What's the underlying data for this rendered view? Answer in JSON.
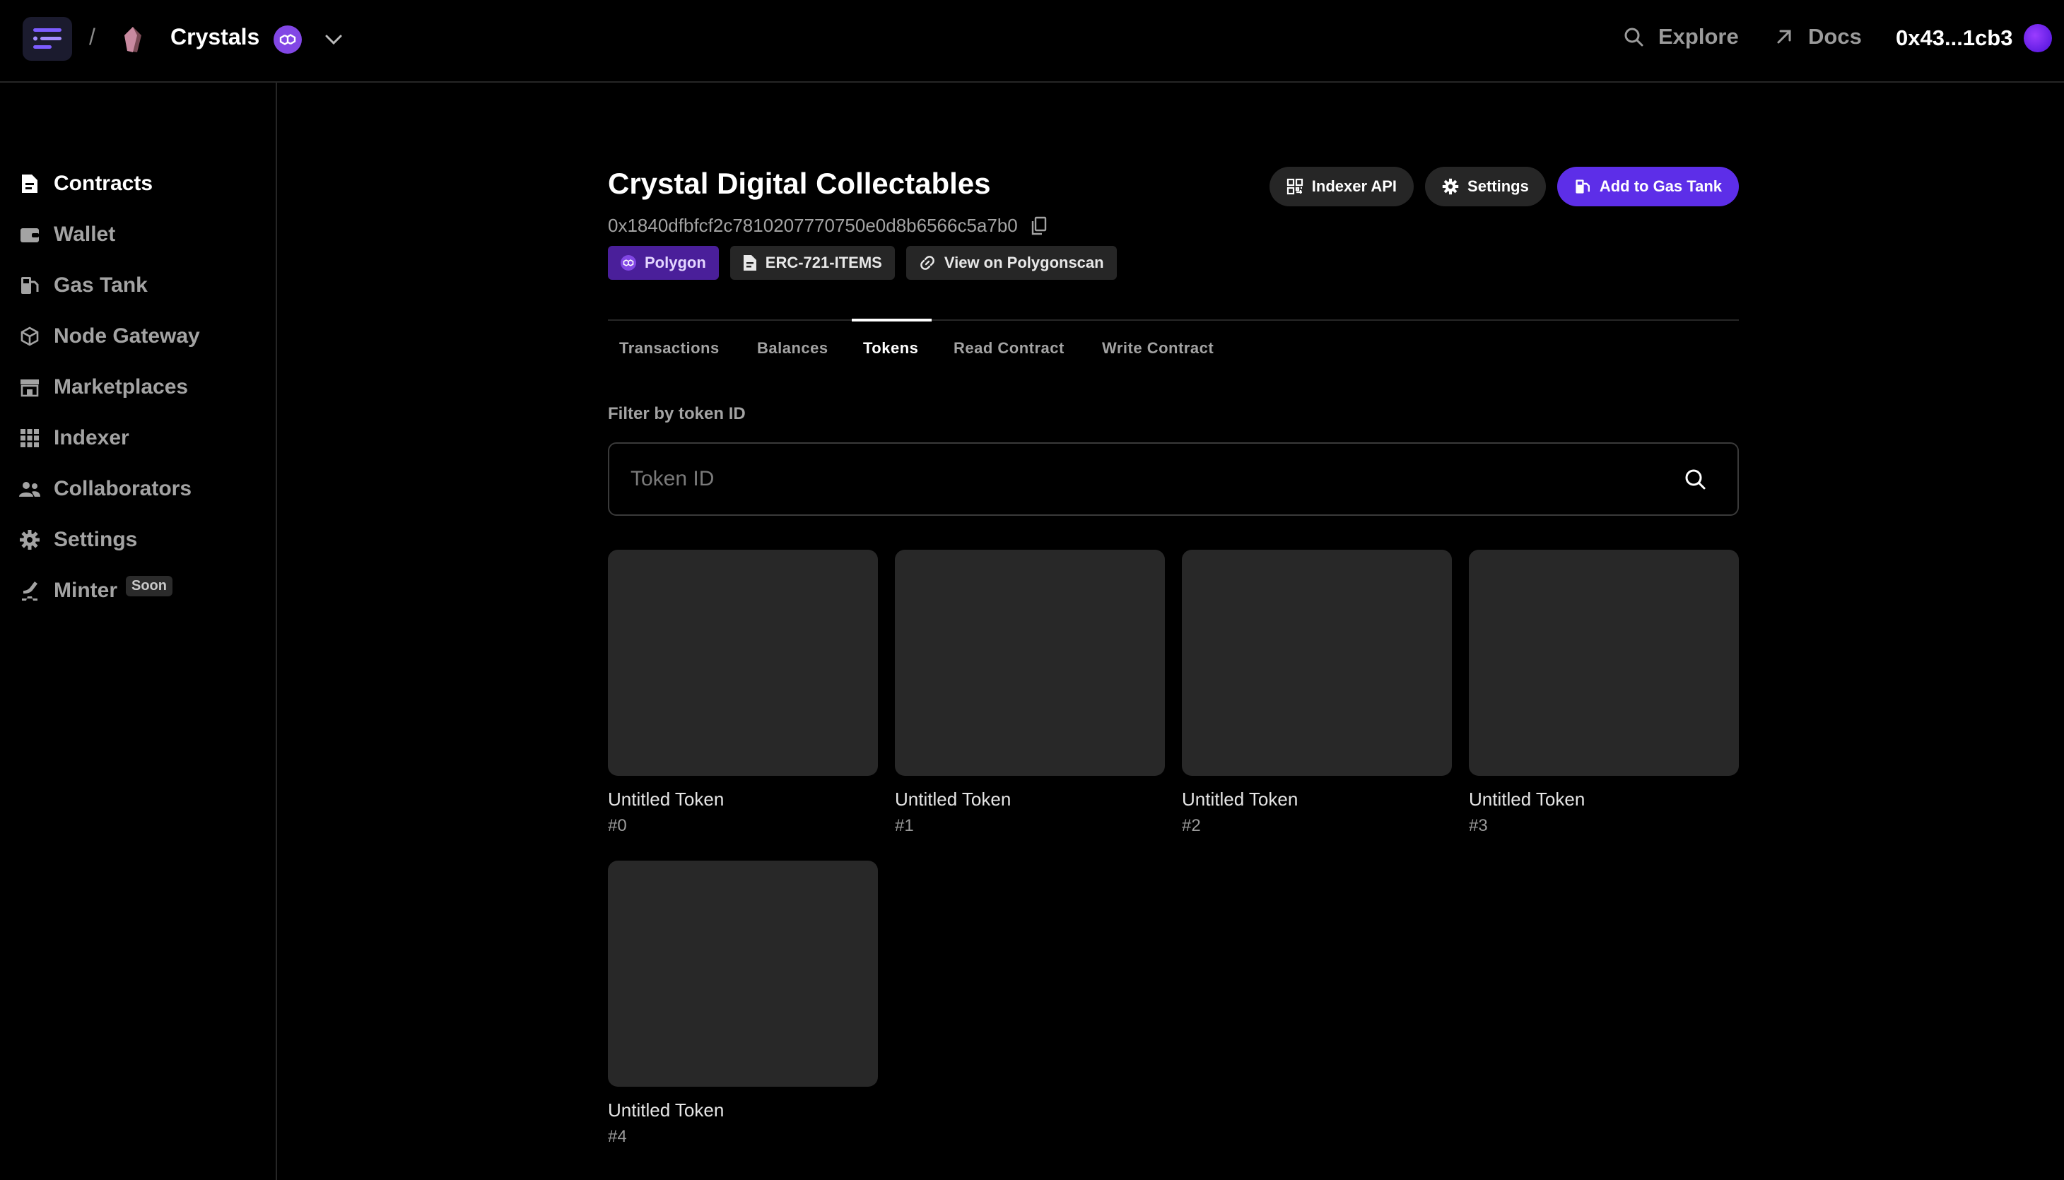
{
  "topbar": {
    "separator": "/",
    "project_name": "Crystals",
    "explore_label": "Explore",
    "docs_label": "Docs",
    "wallet_address": "0x43...1cb3"
  },
  "sidebar": {
    "items": [
      {
        "label": "Contracts",
        "icon": "contract-icon",
        "active": true
      },
      {
        "label": "Wallet",
        "icon": "wallet-icon"
      },
      {
        "label": "Gas Tank",
        "icon": "gas-pump-icon"
      },
      {
        "label": "Node Gateway",
        "icon": "cube-icon"
      },
      {
        "label": "Marketplaces",
        "icon": "storefront-icon"
      },
      {
        "label": "Indexer",
        "icon": "grid-icon"
      },
      {
        "label": "Collaborators",
        "icon": "users-icon"
      },
      {
        "label": "Settings",
        "icon": "gear-icon"
      },
      {
        "label": "Minter",
        "icon": "hammer-icon",
        "badge": "Soon"
      }
    ]
  },
  "contract": {
    "title": "Crystal Digital Collectables",
    "address": "0x1840dfbfcf2c7810207770750e0d8b6566c5a7b0",
    "network_badge": "Polygon",
    "type_badge": "ERC-721-ITEMS",
    "explorer_link": "View on Polygonscan"
  },
  "actions": {
    "indexer_api": "Indexer API",
    "settings": "Settings",
    "add_to_gas_tank": "Add to Gas Tank"
  },
  "tabs": [
    {
      "label": "Transactions"
    },
    {
      "label": "Balances"
    },
    {
      "label": "Tokens",
      "active": true
    },
    {
      "label": "Read Contract"
    },
    {
      "label": "Write Contract"
    }
  ],
  "filter": {
    "label": "Filter by token ID",
    "placeholder": "Token ID",
    "value": ""
  },
  "tokens": [
    {
      "name": "Untitled Token",
      "id": "#0"
    },
    {
      "name": "Untitled Token",
      "id": "#1"
    },
    {
      "name": "Untitled Token",
      "id": "#2"
    },
    {
      "name": "Untitled Token",
      "id": "#3"
    },
    {
      "name": "Untitled Token",
      "id": "#4"
    }
  ],
  "colors": {
    "background": "#000000",
    "accent": "#5d2ee8",
    "polygon": "#8247e5",
    "card": "#282828"
  }
}
